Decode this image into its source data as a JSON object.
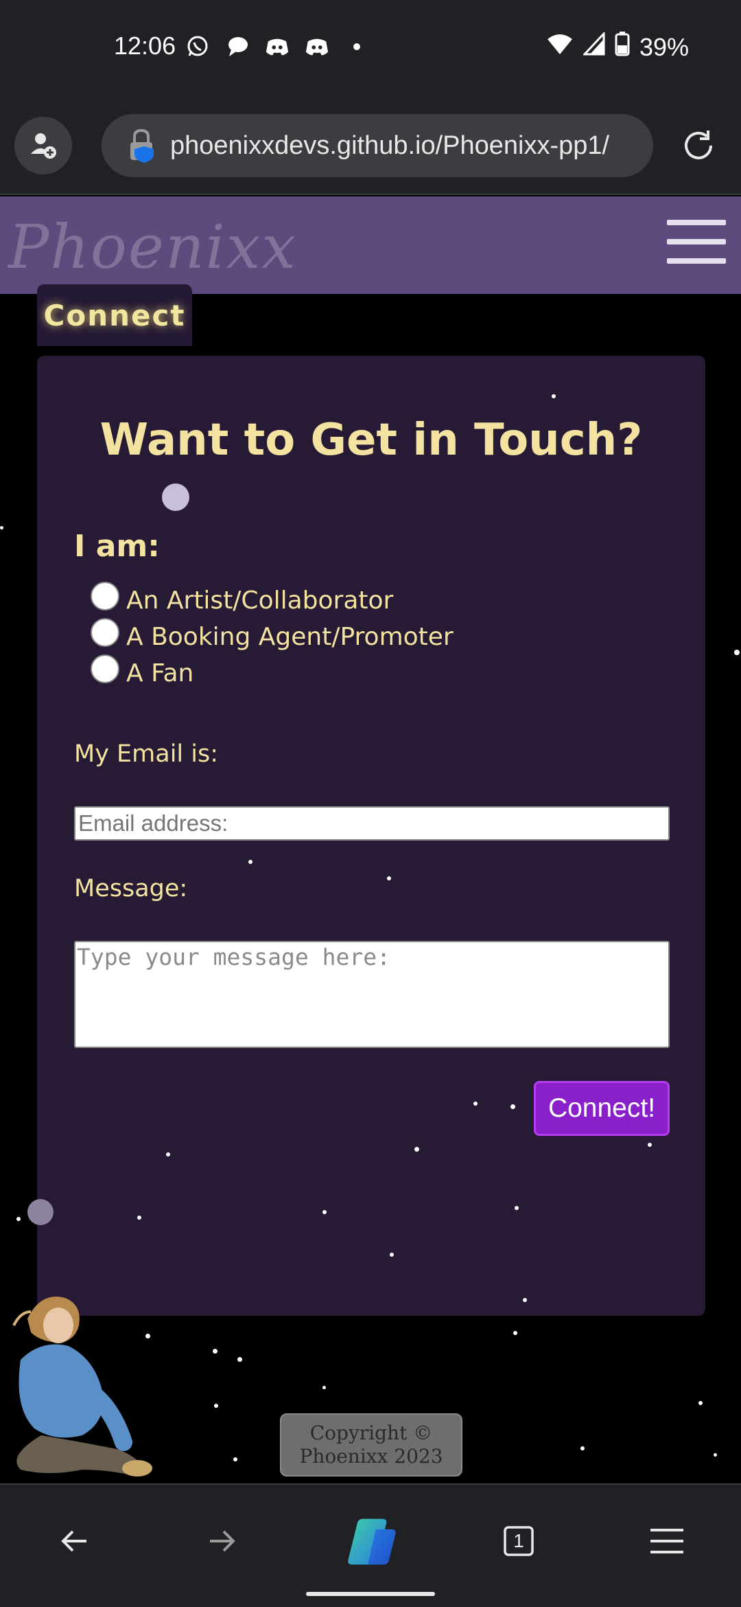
{
  "status_bar": {
    "time": "12:06",
    "battery": "39%",
    "notification_icons": [
      "whatsapp-icon",
      "chat-bubble-icon",
      "discord-icon",
      "discord-icon",
      "dot-icon"
    ],
    "right_icons": [
      "wifi-icon",
      "signal-icon",
      "battery-icon"
    ]
  },
  "browser": {
    "url": "phoenixxdevs.github.io/Phoenixx-pp1/"
  },
  "site": {
    "logo": "Phoenixx",
    "tab_label": "Connect",
    "form": {
      "title": "Want to Get in Touch?",
      "iam_label": "I am:",
      "options": [
        {
          "label": "An Artist/Collaborator"
        },
        {
          "label": "A Booking Agent/Promoter"
        },
        {
          "label": "A Fan"
        }
      ],
      "email_label": "My Email is:",
      "email_placeholder": "Email address:",
      "message_label": "Message:",
      "message_placeholder": "Type your message here:",
      "submit_label": "Connect!"
    },
    "copyright_line1": "Copyright ©",
    "copyright_line2": "Phoenixx 2023"
  },
  "bottom_nav": {
    "tab_count": "1"
  },
  "colors": {
    "header_bg": "#5e4b7d",
    "card_bg": "#261a34",
    "accent_text": "#f3e2a0",
    "button_bg": "#8a20c9"
  }
}
